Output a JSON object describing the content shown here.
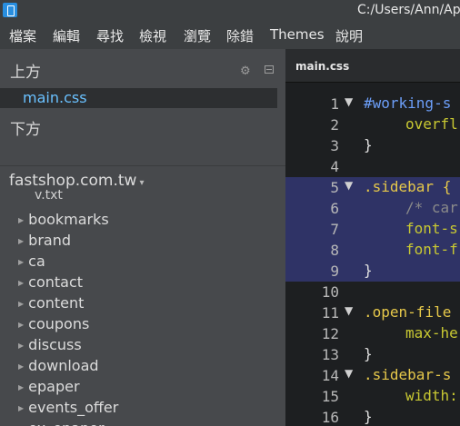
{
  "window": {
    "title": "C:/Users/Ann/Ap"
  },
  "menu": [
    "檔案",
    "編輯",
    "尋找",
    "檢視",
    "瀏覽",
    "除錯",
    "Themes",
    "說明"
  ],
  "sidebar": {
    "working_header": "上方",
    "working_files": [
      "main.css"
    ],
    "lower_header": "下方",
    "project_name": "fastshop.com.tw",
    "partial_item": "v.txt",
    "folders": [
      "bookmarks",
      "brand",
      "ca",
      "contact",
      "content",
      "coupons",
      "discuss",
      "download",
      "epaper",
      "events_offer",
      "ex_epaper"
    ]
  },
  "editor": {
    "tab": "main.css",
    "lines": [
      {
        "n": "1",
        "fold": true,
        "text": "#working-s",
        "cls": "c-sel",
        "indent": false,
        "sel": false
      },
      {
        "n": "2",
        "fold": false,
        "text": "overfl",
        "cls": "c-prop",
        "indent": true,
        "sel": false
      },
      {
        "n": "3",
        "fold": false,
        "text": "}",
        "cls": "c-brace",
        "indent": false,
        "sel": false
      },
      {
        "n": "4",
        "fold": false,
        "text": "",
        "cls": "c-brace",
        "indent": false,
        "sel": false
      },
      {
        "n": "5",
        "fold": true,
        "text": ".sidebar {",
        "cls": "c-class",
        "indent": false,
        "sel": true
      },
      {
        "n": "6",
        "fold": false,
        "text": "/* car",
        "cls": "c-comment",
        "indent": true,
        "sel": true
      },
      {
        "n": "7",
        "fold": false,
        "text": "font-s",
        "cls": "c-prop",
        "indent": true,
        "sel": true
      },
      {
        "n": "8",
        "fold": false,
        "text": "font-f",
        "cls": "c-prop",
        "indent": true,
        "sel": true
      },
      {
        "n": "9",
        "fold": false,
        "text": "}",
        "cls": "c-brace",
        "indent": false,
        "sel": true
      },
      {
        "n": "10",
        "fold": false,
        "text": "",
        "cls": "c-brace",
        "indent": false,
        "sel": false
      },
      {
        "n": "11",
        "fold": true,
        "text": ".open-file",
        "cls": "c-class",
        "indent": false,
        "sel": false
      },
      {
        "n": "12",
        "fold": false,
        "text": "max-he",
        "cls": "c-prop",
        "indent": true,
        "sel": false
      },
      {
        "n": "13",
        "fold": false,
        "text": "}",
        "cls": "c-brace",
        "indent": false,
        "sel": false
      },
      {
        "n": "14",
        "fold": true,
        "text": ".sidebar-s",
        "cls": "c-class",
        "indent": false,
        "sel": false
      },
      {
        "n": "15",
        "fold": false,
        "text": "width:",
        "cls": "c-prop",
        "indent": true,
        "sel": false
      },
      {
        "n": "16",
        "fold": false,
        "text": "}",
        "cls": "c-brace",
        "indent": false,
        "sel": false
      }
    ]
  }
}
